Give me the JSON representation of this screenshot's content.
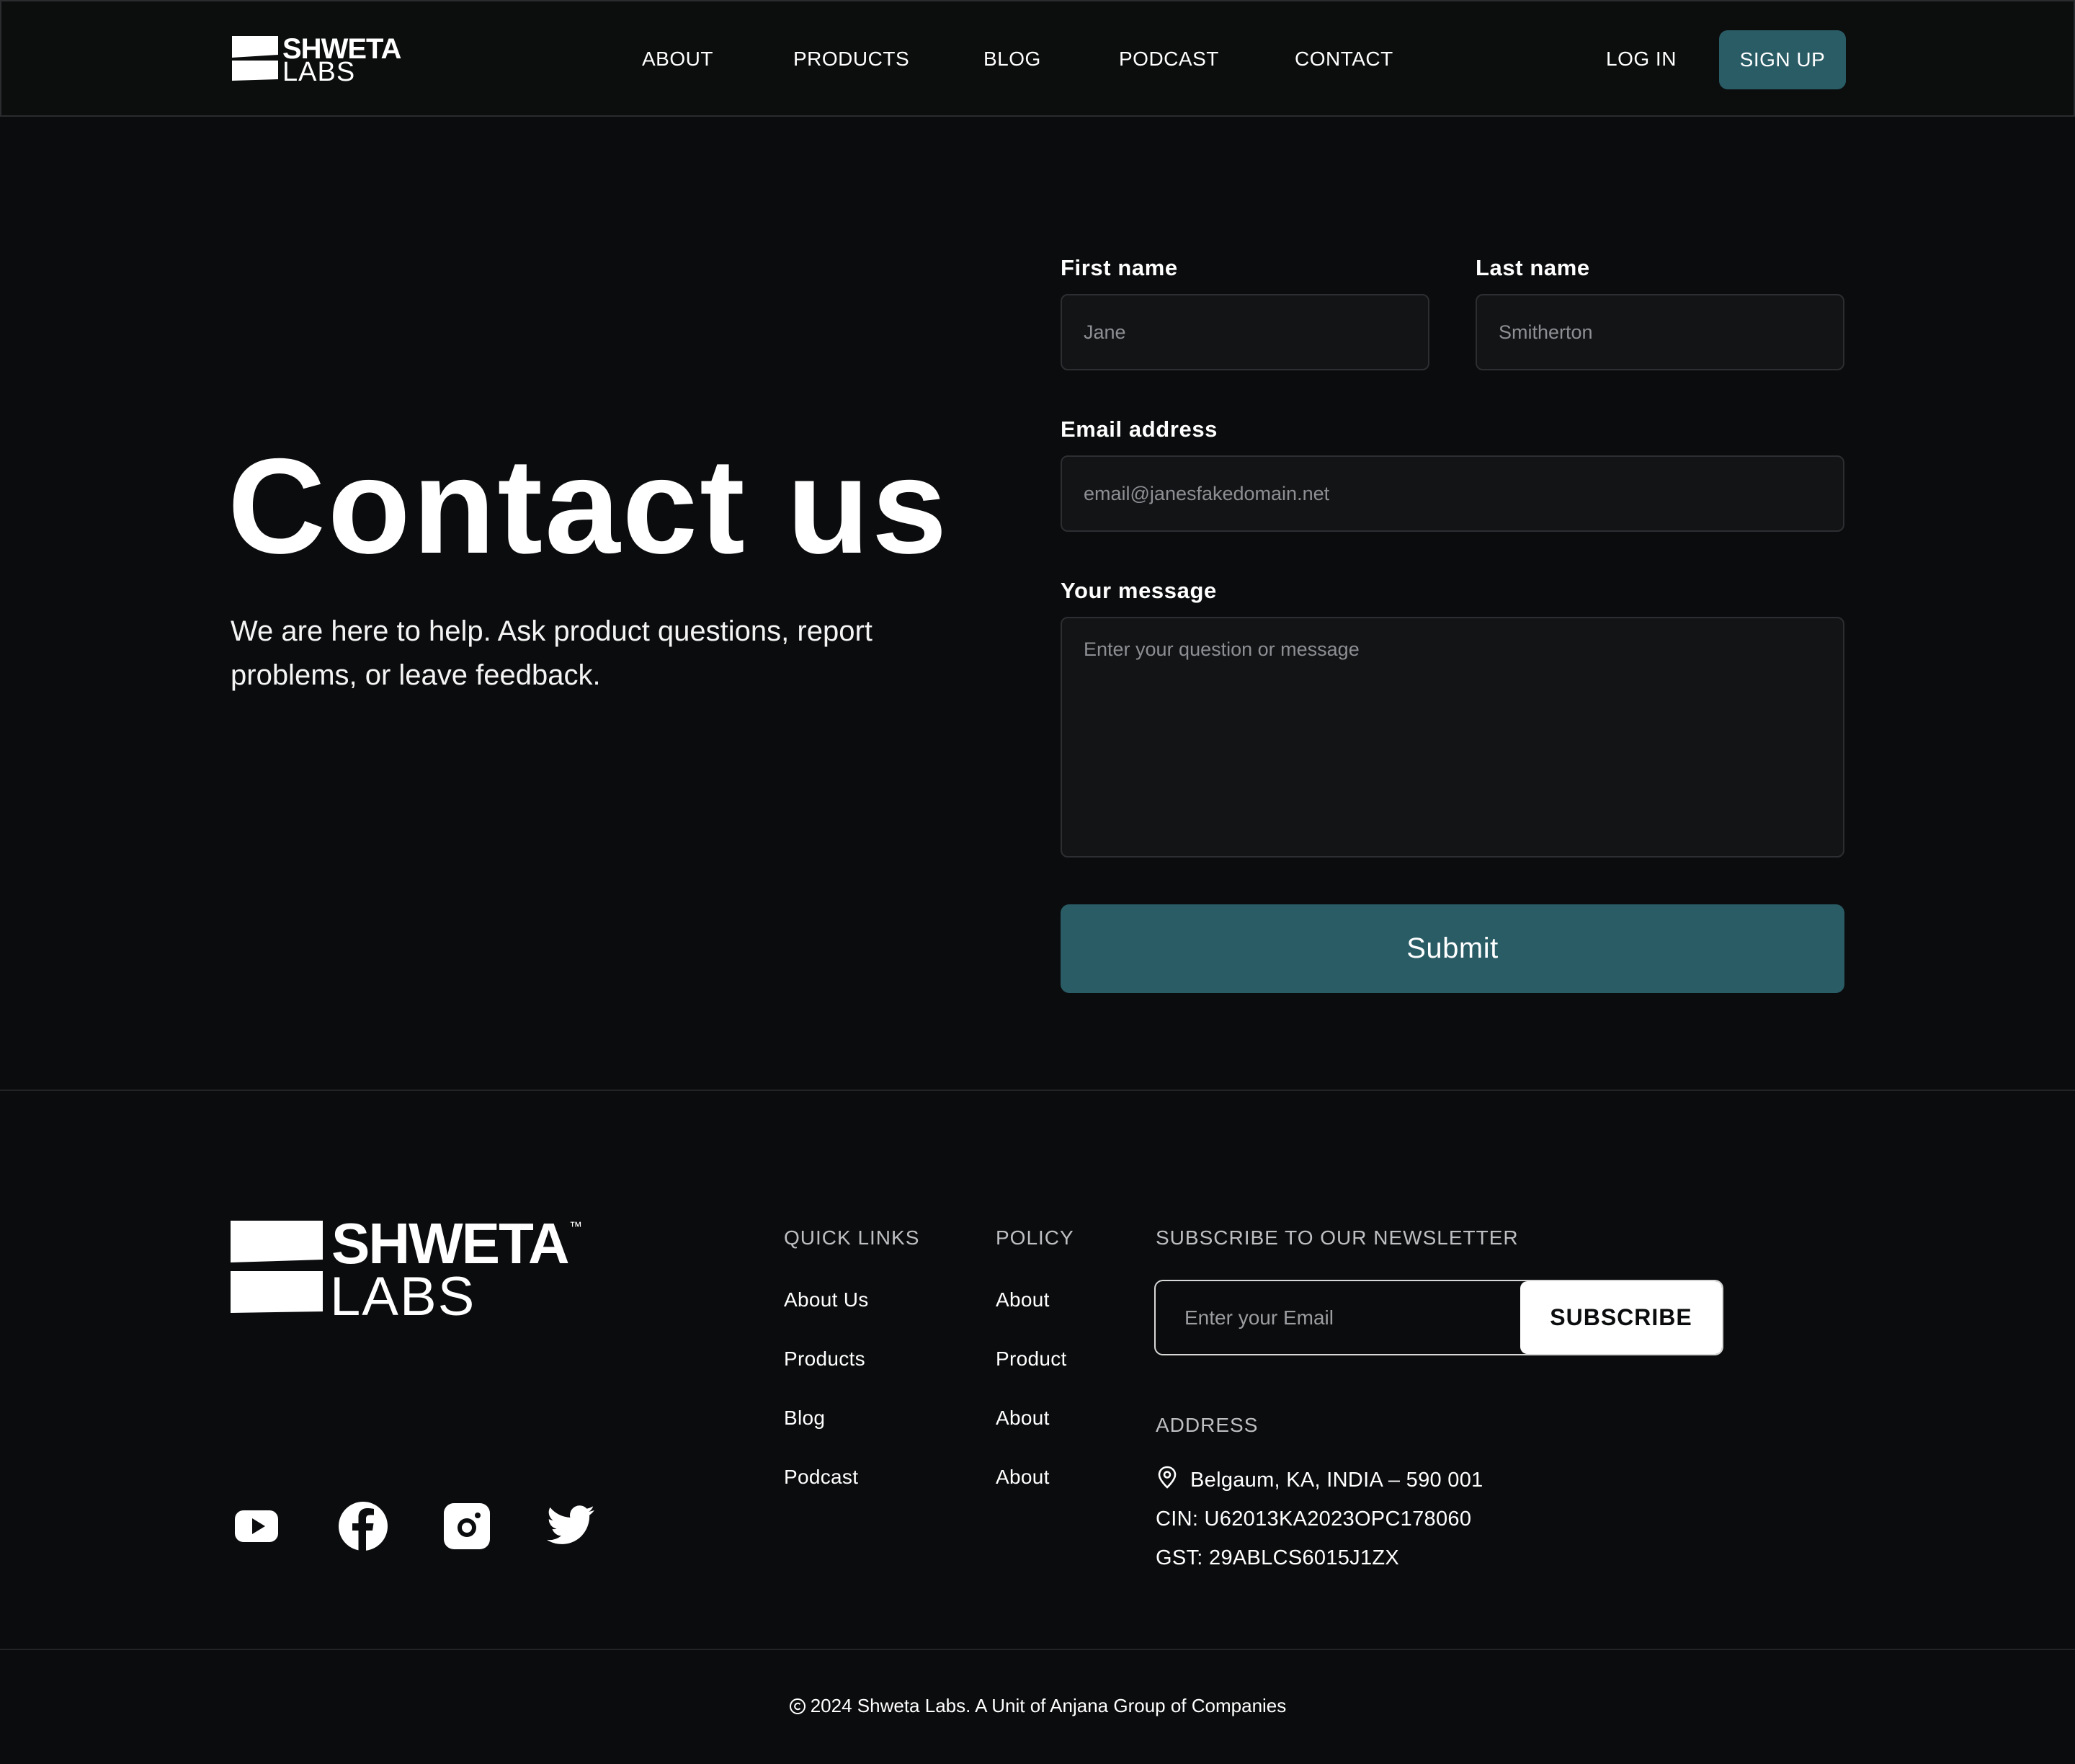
{
  "header": {
    "logo": {
      "line1": "SHWETA",
      "line2": "LABS"
    },
    "nav": [
      {
        "label": "ABOUT"
      },
      {
        "label": "PRODUCTS"
      },
      {
        "label": "BLOG"
      },
      {
        "label": "PODCAST"
      },
      {
        "label": "CONTACT"
      }
    ],
    "login_label": "LOG IN",
    "signup_label": "SIGN UP"
  },
  "hero": {
    "title": "Contact us",
    "subtitle": "We are here to help. Ask product questions, report problems, or leave feedback."
  },
  "form": {
    "first_name": {
      "label": "First name",
      "placeholder": "Jane"
    },
    "last_name": {
      "label": "Last name",
      "placeholder": "Smitherton"
    },
    "email": {
      "label": "Email address",
      "placeholder": "email@janesfakedomain.net"
    },
    "message": {
      "label": "Your message",
      "placeholder": "Enter your question or message"
    },
    "submit_label": "Submit"
  },
  "footer": {
    "logo": {
      "line1": "SHWETA",
      "line2": "LABS",
      "tm": "™"
    },
    "social": [
      {
        "icon": "youtube-icon"
      },
      {
        "icon": "facebook-icon"
      },
      {
        "icon": "instagram-icon"
      },
      {
        "icon": "twitter-icon"
      }
    ],
    "quick_links": {
      "heading": "QUICK LINKS",
      "items": [
        "About Us",
        "Products",
        "Blog",
        "Podcast"
      ]
    },
    "policy": {
      "heading": "POLICY",
      "items": [
        "About",
        "Product",
        "About",
        "About"
      ]
    },
    "newsletter": {
      "heading": "SUBSCRIBE TO OUR NEWSLETTER",
      "placeholder": "Enter your Email",
      "button_label": "SUBSCRIBE"
    },
    "address": {
      "heading": "ADDRESS",
      "location": "Belgaum, KA, INDIA – 590 001",
      "cin": "CIN: U62013KA2023OPC178060",
      "gst": "GST: 29ABLCS6015J1ZX"
    },
    "copyright": "2024 Shweta Labs. A Unit of Anjana Group of Companies"
  },
  "colors": {
    "background": "#0b0c0d",
    "accent": "#2a5c66",
    "field_bg": "#131416",
    "text": "#ffffff"
  }
}
